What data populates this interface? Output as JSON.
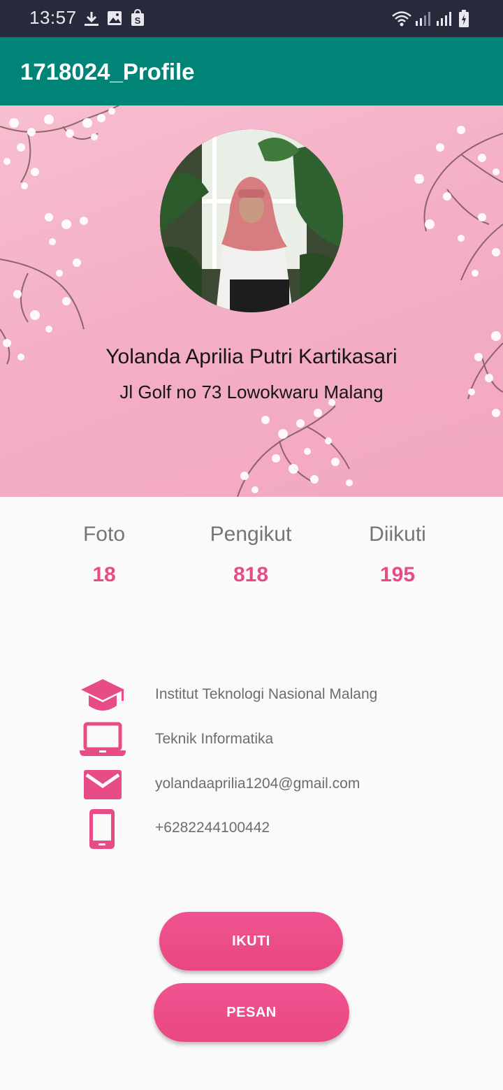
{
  "status_bar": {
    "time": "13:57",
    "left_icons": [
      "download-icon",
      "image-icon",
      "shop-icon"
    ],
    "right_icons": [
      "wifi-icon",
      "signal-icon",
      "signal-icon",
      "battery-icon"
    ]
  },
  "app_bar": {
    "title": "1718024_Profile",
    "color": "#008477"
  },
  "profile": {
    "name": "Yolanda Aprilia Putri Kartikasari",
    "address": "Jl Golf no 73 Lowokwaru Malang"
  },
  "stats": [
    {
      "label": "Foto",
      "value": "18"
    },
    {
      "label": "Pengikut",
      "value": "818"
    },
    {
      "label": "Diikuti",
      "value": "195"
    }
  ],
  "info": [
    {
      "icon": "graduation-cap-icon",
      "text": "Institut Teknologi Nasional Malang"
    },
    {
      "icon": "laptop-icon",
      "text": "Teknik Informatika"
    },
    {
      "icon": "email-icon",
      "text": "yolandaaprilia1204@gmail.com"
    },
    {
      "icon": "phone-icon",
      "text": "+6282244100442"
    }
  ],
  "buttons": {
    "follow": "IKUTI",
    "message": "PESAN"
  },
  "accent_color": "#e84c86"
}
